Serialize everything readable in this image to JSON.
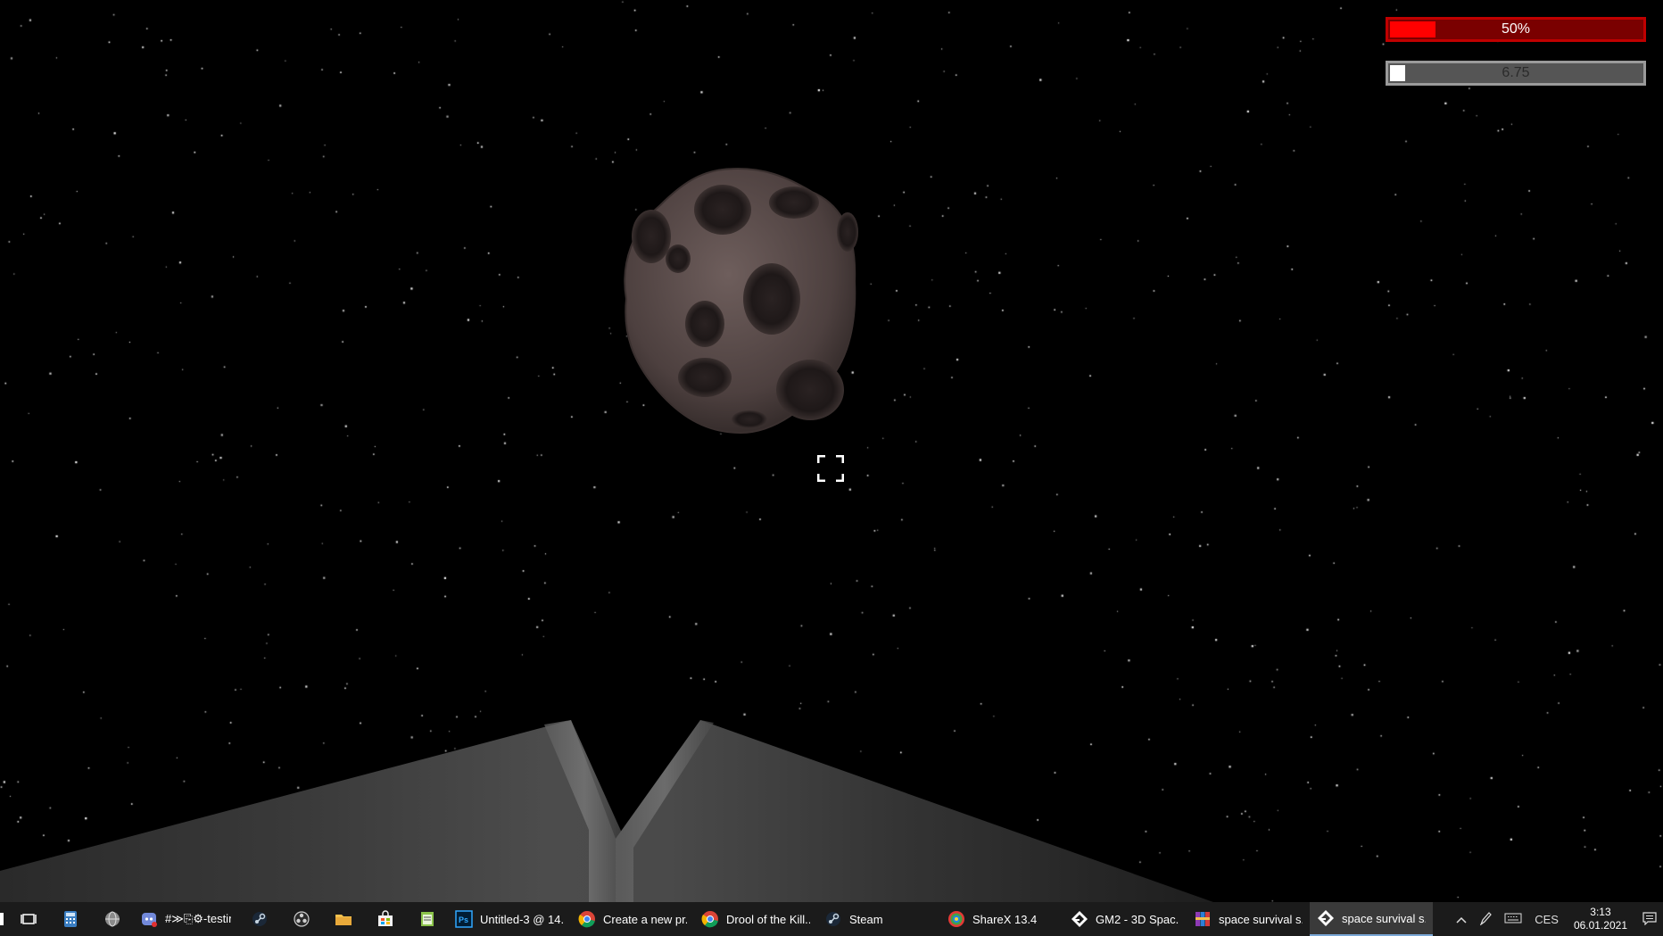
{
  "hud": {
    "health": {
      "text": "50%",
      "fraction": 0.18,
      "fill_color": "#ff0000",
      "track_color": "#7a0000"
    },
    "energy": {
      "text": "6.75",
      "fraction": 0.06,
      "fill_color": "#ffffff",
      "track_color": "#555555"
    }
  },
  "scene": {
    "background": "#000000",
    "objects": [
      "asteroid",
      "crosshair",
      "ship-nose",
      "starfield"
    ]
  },
  "taskbar": {
    "pinned_icons": [
      "task-view-icon",
      "calculator-icon",
      "globe-icon"
    ],
    "apps": [
      {
        "icon": "discord-icon",
        "label": "#≫⎘⚙-testing..."
      },
      {
        "icon": "steam-icon",
        "label": ""
      },
      {
        "icon": "obs-icon",
        "label": ""
      },
      {
        "icon": "folder-icon",
        "label": ""
      },
      {
        "icon": "store-icon",
        "label": ""
      },
      {
        "icon": "notepad-icon",
        "label": ""
      }
    ],
    "windows": [
      {
        "icon": "photoshop-icon",
        "label": "Untitled-3 @ 14..."
      },
      {
        "icon": "chrome-icon",
        "label": "Create a new pr..."
      },
      {
        "icon": "chrome-icon",
        "label": "Drool of the Kill..."
      },
      {
        "icon": "steam-icon",
        "label": "Steam"
      },
      {
        "icon": "sharex-icon",
        "label": "ShareX 13.4"
      },
      {
        "icon": "gamemaker-icon",
        "label": "GM2 - 3D Spac..."
      },
      {
        "icon": "winrar-icon",
        "label": "space survival s..."
      },
      {
        "icon": "gamemaker-icon",
        "label": "space survival s...",
        "active": true
      }
    ],
    "tray": {
      "language": "CES",
      "time": "3:13",
      "date": "06.01.2021"
    }
  }
}
